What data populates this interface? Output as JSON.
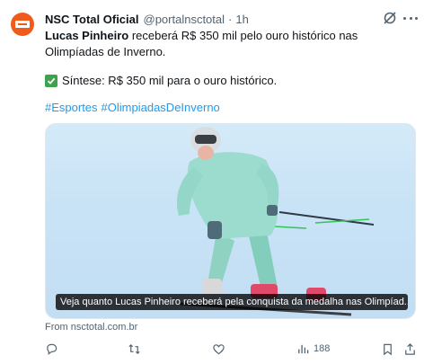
{
  "tweet": {
    "display_name": "NSC Total Oficial",
    "handle": "@portalnsctotal",
    "separator": "·",
    "time": "1h",
    "text_bold": "Lucas Pinheiro",
    "text_rest": " receberá R$ 350 mil pelo ouro histórico nas Olimpíadas de Inverno.",
    "summary": "Síntese: R$ 350 mil para o ouro histórico.",
    "hashtags": [
      "#Esportes",
      "#OlimpiadasDeInverno"
    ],
    "media_caption": "Veja quanto Lucas Pinheiro receberá pela conquista da medalha nas Olimpíad...",
    "source": "From nsctotal.com.br",
    "views_count": "188"
  },
  "colors": {
    "brand": "#f05a1a",
    "link": "#1d9bf0",
    "muted": "#536471",
    "check": "#3fa34d"
  },
  "icons": [
    "grok-icon",
    "more-icon",
    "check-icon",
    "reply-icon",
    "retweet-icon",
    "like-icon",
    "views-icon",
    "bookmark-icon",
    "share-icon"
  ]
}
